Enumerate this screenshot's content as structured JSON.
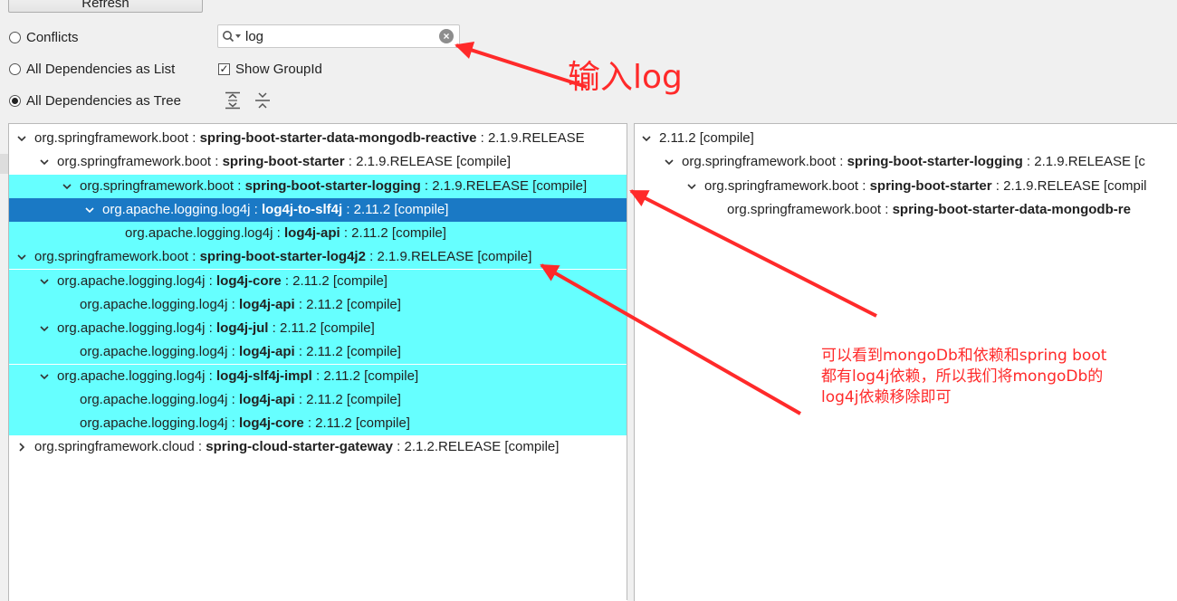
{
  "toolbar": {
    "refresh_label": "Refresh",
    "search": {
      "value": "log"
    },
    "options": [
      {
        "label": "Conflicts",
        "selected": false
      },
      {
        "label": "All Dependencies as List",
        "selected": false
      },
      {
        "label": "All Dependencies as Tree",
        "selected": true
      }
    ],
    "show_group_id": {
      "label": "Show GroupId",
      "checked": true
    }
  },
  "left_tree": [
    {
      "group": "org.springframework.boot",
      "artifact": "spring-boot-starter-data-mongodb-reactive",
      "suffix": " : 2.1.9.RELEASE",
      "indent": 0,
      "expander": "down",
      "style": "normal"
    },
    {
      "group": "org.springframework.boot",
      "artifact": "spring-boot-starter",
      "suffix": " : 2.1.9.RELEASE [compile]",
      "indent": 1,
      "expander": "down",
      "style": "normal"
    },
    {
      "group": "org.springframework.boot",
      "artifact": "spring-boot-starter-logging",
      "suffix": " : 2.1.9.RELEASE [compile]",
      "indent": 2,
      "expander": "down",
      "style": "highlight"
    },
    {
      "group": "org.apache.logging.log4j",
      "artifact": "log4j-to-slf4j",
      "suffix": " : 2.11.2 [compile]",
      "indent": 3,
      "expander": "down",
      "style": "selected"
    },
    {
      "group": "org.apache.logging.log4j",
      "artifact": "log4j-api",
      "suffix": " : 2.11.2 [compile]",
      "indent": 4,
      "expander": "",
      "style": "highlight"
    },
    {
      "group": "org.springframework.boot",
      "artifact": "spring-boot-starter-log4j2",
      "suffix": " : 2.1.9.RELEASE [compile]",
      "indent": 0,
      "expander": "down",
      "style": "highlight"
    },
    {
      "group": "org.apache.logging.log4j",
      "artifact": "log4j-core",
      "suffix": " : 2.11.2 [compile]",
      "indent": 1,
      "expander": "down",
      "style": "highlight"
    },
    {
      "group": "org.apache.logging.log4j",
      "artifact": "log4j-api",
      "suffix": " : 2.11.2 [compile]",
      "indent": 2,
      "expander": "",
      "style": "highlight"
    },
    {
      "group": "org.apache.logging.log4j",
      "artifact": "log4j-jul",
      "suffix": " : 2.11.2 [compile]",
      "indent": 1,
      "expander": "down",
      "style": "highlight"
    },
    {
      "group": "org.apache.logging.log4j",
      "artifact": "log4j-api",
      "suffix": " : 2.11.2 [compile]",
      "indent": 2,
      "expander": "",
      "style": "highlight"
    },
    {
      "group": "org.apache.logging.log4j",
      "artifact": "log4j-slf4j-impl",
      "suffix": " : 2.11.2 [compile]",
      "indent": 1,
      "expander": "down",
      "style": "highlight"
    },
    {
      "group": "org.apache.logging.log4j",
      "artifact": "log4j-api",
      "suffix": " : 2.11.2 [compile]",
      "indent": 2,
      "expander": "",
      "style": "highlight"
    },
    {
      "group": "org.apache.logging.log4j",
      "artifact": "log4j-core",
      "suffix": " : 2.11.2 [compile]",
      "indent": 2,
      "expander": "",
      "style": "highlight"
    },
    {
      "group": "org.springframework.cloud",
      "artifact": "spring-cloud-starter-gateway",
      "suffix": " : 2.1.2.RELEASE [compile]",
      "indent": 0,
      "expander": "right",
      "style": "normal"
    }
  ],
  "right_tree": [
    {
      "group": "",
      "artifact": "",
      "suffix": "2.11.2 [compile]",
      "indent": 0,
      "expander": "down"
    },
    {
      "group": "org.springframework.boot",
      "artifact": "spring-boot-starter-logging",
      "suffix": " : 2.1.9.RELEASE [c",
      "indent": 1,
      "expander": "down"
    },
    {
      "group": "org.springframework.boot",
      "artifact": "spring-boot-starter",
      "suffix": " : 2.1.9.RELEASE [compil",
      "indent": 2,
      "expander": "down"
    },
    {
      "group": "org.springframework.boot",
      "artifact": "spring-boot-starter-data-mongodb-re",
      "suffix": "",
      "indent": 3,
      "expander": ""
    }
  ],
  "annotations": {
    "input_hint": "输入log",
    "note_lines": [
      "可以看到mongoDb和依赖和spring boot",
      "都有log4j依赖，所以我们将mongoDb的",
      "log4j依赖移除即可"
    ],
    "color": "#ff2a2a"
  },
  "colors": {
    "highlight": "#66ffff",
    "selected": "#1a79c5"
  }
}
